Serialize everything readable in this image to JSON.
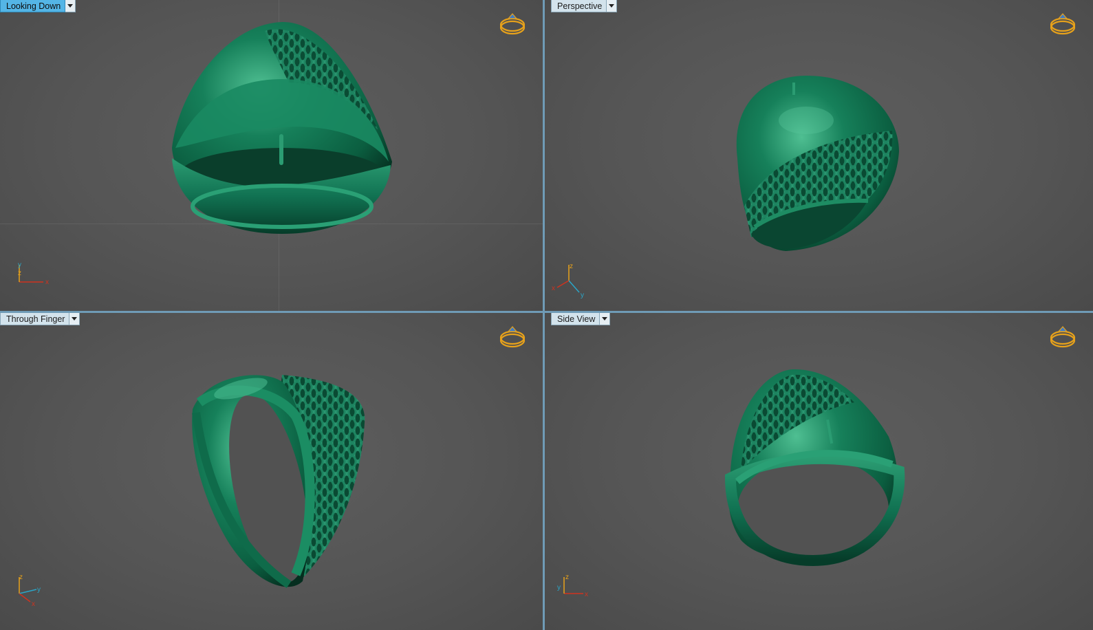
{
  "viewports": [
    {
      "id": "top-left",
      "label": "Looking Down",
      "active": true,
      "axes": [
        "y",
        "z",
        "x"
      ]
    },
    {
      "id": "top-right",
      "label": "Perspective",
      "active": false,
      "axes": [
        "z",
        "x",
        "y"
      ]
    },
    {
      "id": "bottom-left",
      "label": "Through Finger",
      "active": false,
      "axes": [
        "z",
        "y",
        "x"
      ]
    },
    {
      "id": "bottom-right",
      "label": "Side View",
      "active": false,
      "axes": [
        "z",
        "y",
        "x"
      ]
    }
  ],
  "colors": {
    "ring": "#0f6b4a",
    "ring_highlight": "#3aa57c",
    "ring_shadow": "#063a28",
    "viewport_bg": "#585858",
    "active_label": "#54b5e6",
    "nav_icon": "#e8a21a",
    "axis_x": "#d0321e",
    "axis_y": "#2aa6c8",
    "axis_z": "#e8a21a"
  },
  "icons": {
    "nav": "ring-navigation-icon",
    "dropdown": "chevron-down-icon"
  }
}
